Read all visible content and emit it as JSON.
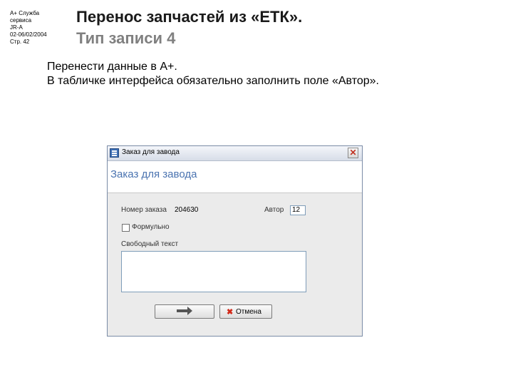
{
  "meta": {
    "lines": [
      "A+ Служба",
      "сервиса",
      "JR-A",
      "02-06/02/2004",
      "Стр. 42"
    ]
  },
  "slide": {
    "title": "Перенос запчастей из «ЕТК».",
    "subtitle": "Тип записи 4",
    "body": [
      "Перенести данные в A+.",
      "В табличке интерфейса обязательно заполнить поле «Автор»."
    ]
  },
  "window": {
    "title": "Заказ для завода",
    "header": "Заказ для завода",
    "order_label": "Номер заказа",
    "order_value": "204630",
    "author_label": "Автор",
    "author_value": "12",
    "checkbox_label": "Формульно",
    "free_text_label": "Свободный текст",
    "free_text_value": "",
    "cancel_label": "Отмена"
  }
}
